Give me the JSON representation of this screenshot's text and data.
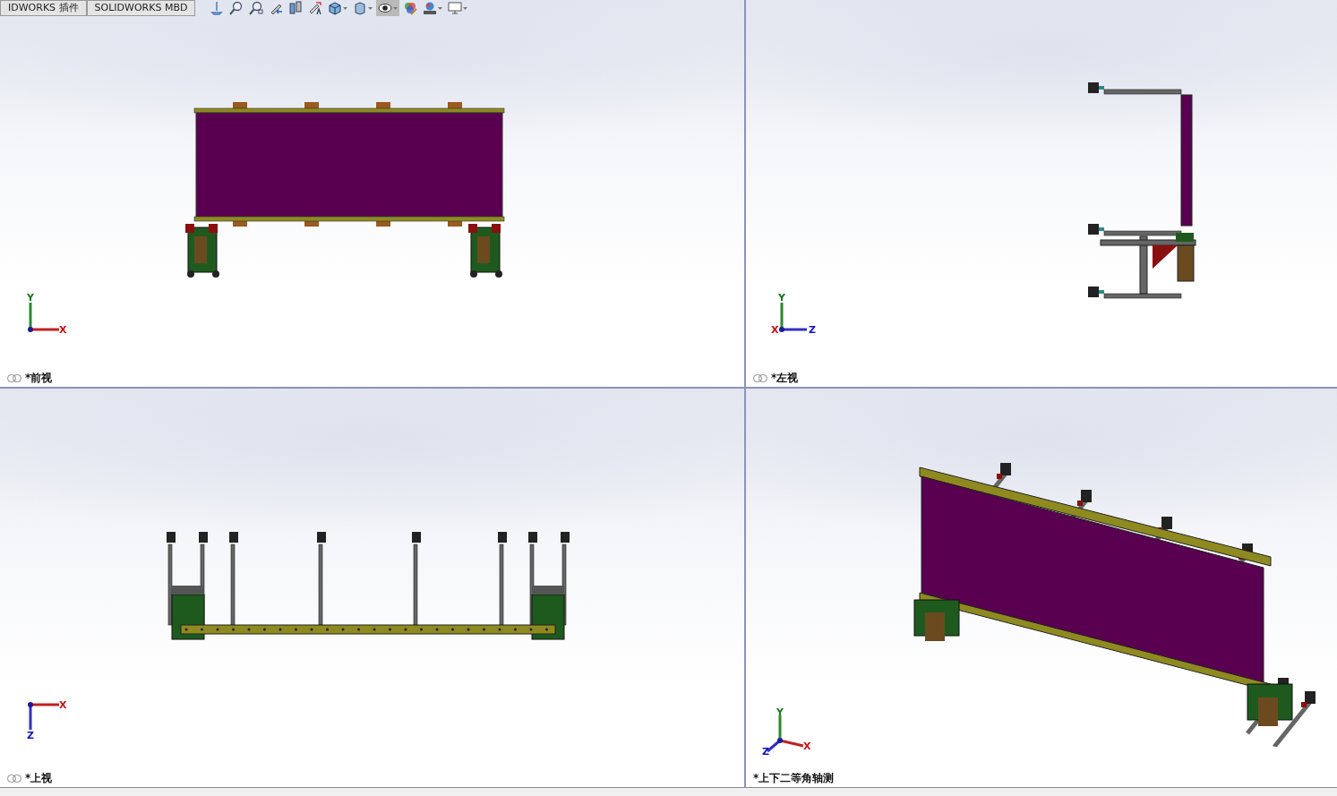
{
  "tabs": [
    {
      "label": "IDWORKS 插件",
      "selected": false
    },
    {
      "label": "SOLIDWORKS MBD",
      "selected": false
    }
  ],
  "toolbar": [
    {
      "kind": "normal",
      "dropdown": false,
      "selected": false
    },
    {
      "kind": "zoom-fit",
      "dropdown": false,
      "selected": false
    },
    {
      "kind": "zoom-area",
      "dropdown": false,
      "selected": false
    },
    {
      "kind": "previous",
      "dropdown": false,
      "selected": false
    },
    {
      "kind": "section",
      "dropdown": false,
      "selected": false
    },
    {
      "kind": "dynamic",
      "dropdown": false,
      "selected": false
    },
    {
      "kind": "orientation",
      "dropdown": true,
      "selected": false
    },
    {
      "kind": "display",
      "dropdown": true,
      "selected": false
    },
    {
      "kind": "hide",
      "dropdown": true,
      "selected": true
    },
    {
      "kind": "appearance",
      "dropdown": false,
      "selected": false
    },
    {
      "kind": "scene",
      "dropdown": true,
      "selected": false
    },
    {
      "kind": "monitor",
      "dropdown": true,
      "selected": false
    }
  ],
  "viewports": [
    {
      "kind": "front",
      "label": "*前视",
      "linked": true,
      "axes": [
        {
          "letter": "Y",
          "color": "#1a7a1a"
        },
        {
          "letter": "X",
          "color": "#d01010"
        }
      ]
    },
    {
      "kind": "left",
      "label": "*左视",
      "linked": true,
      "axes": [
        {
          "letter": "Y",
          "color": "#1a7a1a"
        },
        {
          "letter": "Z",
          "color": "#1010d0"
        },
        {
          "letter": "X",
          "color": "#d01010"
        }
      ]
    },
    {
      "kind": "top",
      "label": "*上视",
      "linked": true,
      "axes": [
        {
          "letter": "X",
          "color": "#d01010"
        },
        {
          "letter": "Z",
          "color": "#1010d0"
        }
      ]
    },
    {
      "kind": "iso",
      "label": "*上下二等角轴测",
      "linked": false,
      "axes": [
        {
          "letter": "Y",
          "color": "#1a7a1a"
        },
        {
          "letter": "X",
          "color": "#d01010"
        },
        {
          "letter": "Z",
          "color": "#1010d0"
        }
      ]
    }
  ]
}
